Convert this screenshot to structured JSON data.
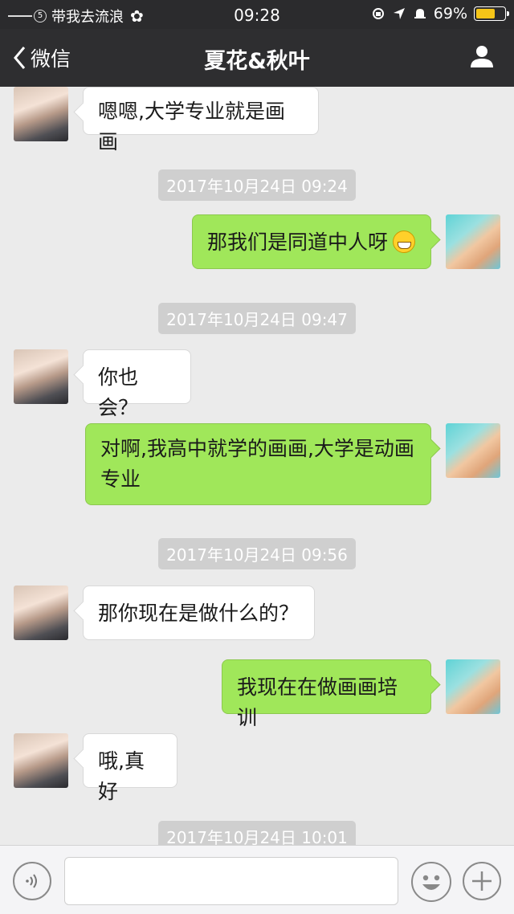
{
  "status_bar": {
    "badge": "5",
    "carrier": "带我去流浪",
    "flower_glyph": "✿",
    "time": "09:28",
    "battery_text": "69%",
    "battery_level": 0.69
  },
  "nav": {
    "back_label": "微信",
    "title": "夏花&秋叶"
  },
  "messages": [
    {
      "side": "left",
      "text": "嗯嗯,大学专业就是画画"
    },
    {
      "type": "timestamp",
      "text": "2017年10月24日 09:24"
    },
    {
      "side": "right",
      "text": "那我们是同道中人呀",
      "emoji": "grinning-emoji"
    },
    {
      "type": "timestamp",
      "text": "2017年10月24日 09:47"
    },
    {
      "side": "left",
      "text": "你也会？"
    },
    {
      "side": "right",
      "line1": "对啊,我高中就学的画画,大学是动画",
      "line2": "专业"
    },
    {
      "type": "timestamp",
      "text": "2017年10月24日 09:56"
    },
    {
      "side": "left",
      "text": "那你现在是做什么的？"
    },
    {
      "side": "right",
      "text": "我现在在做画画培训"
    },
    {
      "side": "left",
      "text": "哦,真好"
    },
    {
      "type": "timestamp",
      "text": "2017年10月24日 10:01"
    }
  ],
  "input_bar": {
    "value": "",
    "icons": [
      "voice-icon",
      "emoji-icon",
      "plus-icon"
    ]
  },
  "colors": {
    "nav_bg": "#2e2e30",
    "chat_bg": "#ebebeb",
    "sent_bubble": "#a0e75a",
    "received_bubble": "#ffffff",
    "timestamp_bg": "#cfcfcf",
    "battery_fill": "#f5c518"
  }
}
